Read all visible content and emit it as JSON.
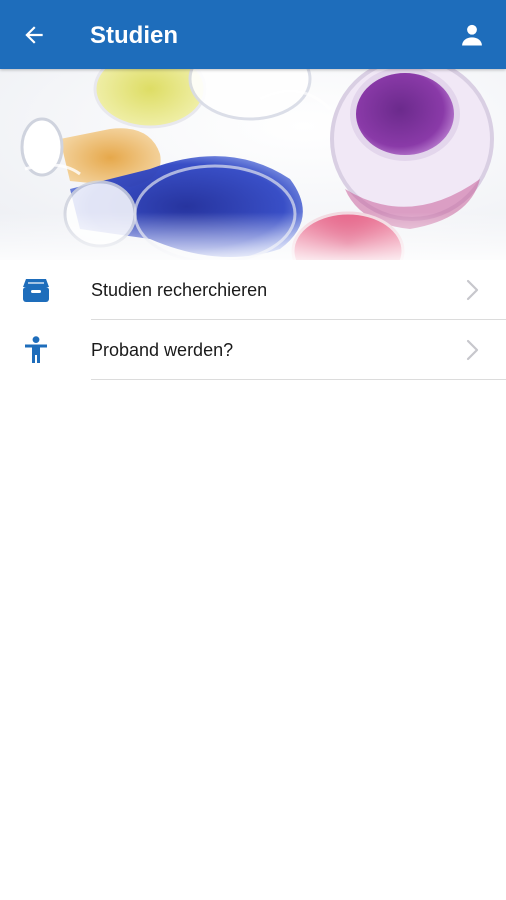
{
  "app_bar": {
    "title": "Studien",
    "back_icon": "arrow-left-icon",
    "account_icon": "person-icon",
    "color": "#1e6dbb"
  },
  "banner": {
    "image": "laboratory-glassware-with-colored-liquids"
  },
  "menu": {
    "items": [
      {
        "label": "Studien recherchieren",
        "icon": "archive-tray-icon"
      },
      {
        "label": "Proband werden?",
        "icon": "accessibility-person-icon"
      }
    ]
  },
  "colors": {
    "accent": "#1e6dbb",
    "chevron": "#c7c7cc",
    "divider": "#dcdcdc"
  }
}
